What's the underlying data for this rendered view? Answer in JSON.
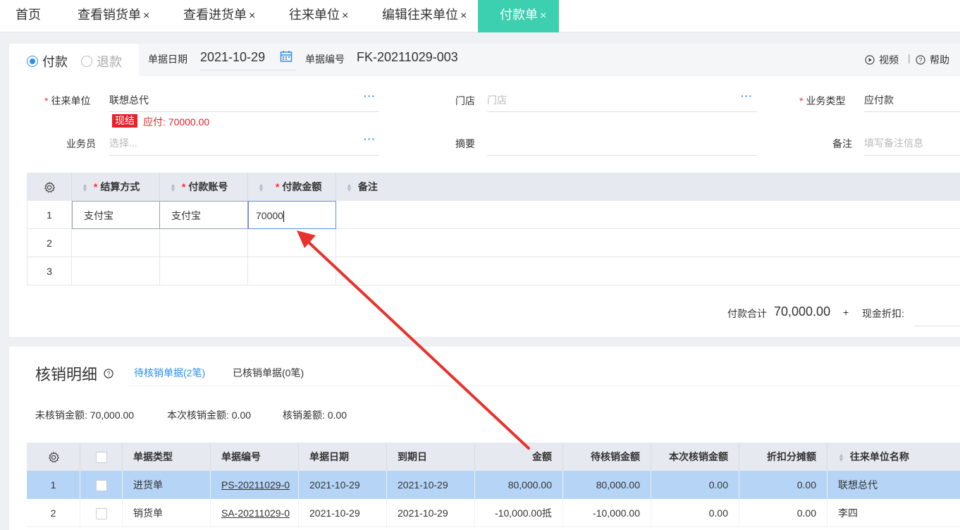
{
  "tabs": [
    {
      "label": "首页",
      "closable": false
    },
    {
      "label": "查看销货单",
      "closable": true
    },
    {
      "label": "查看进货单",
      "closable": true
    },
    {
      "label": "往来单位",
      "closable": true
    },
    {
      "label": "编辑往来单位",
      "closable": true
    },
    {
      "label": "付款单",
      "closable": true,
      "active": true
    }
  ],
  "close_glyph": "×",
  "header": {
    "radio_pay": "付款",
    "radio_refund": "退款",
    "date_label": "单据日期",
    "date_value": "2021-10-29",
    "no_label": "单据编号",
    "no_value": "FK-20211029-003",
    "video_label": "视频",
    "sep": "|",
    "help_label": "帮助"
  },
  "form": {
    "partner_label": "往来单位",
    "partner_value": "联想总代",
    "settle_badge": "现结",
    "payable_text": "应付: 70000.00",
    "store_label": "门店",
    "store_placeholder": "门店",
    "biz_type_label": "业务类型",
    "biz_type_value": "应付款",
    "staff_label": "业务员",
    "staff_placeholder": "选择...",
    "summary_label": "摘要",
    "remark_label": "备注",
    "remark_placeholder": "填写备注信息",
    "more_glyph": "···",
    "required_mark": "*"
  },
  "pay_grid": {
    "headers": [
      "结算方式",
      "付款账号",
      "付款金额",
      "备注"
    ],
    "rows": [
      {
        "no": "1",
        "method": "支付宝",
        "account": "支付宝",
        "amount": "70000",
        "note": ""
      },
      {
        "no": "2",
        "method": "",
        "account": "",
        "amount": "",
        "note": ""
      },
      {
        "no": "3",
        "method": "",
        "account": "",
        "amount": "",
        "note": ""
      }
    ],
    "total_label": "付款合计",
    "total_value": "70,000.00",
    "plus": "+",
    "discount_label": "现金折扣:"
  },
  "verify": {
    "title": "核销明细",
    "tab_pending": "待核销单据(2笔)",
    "tab_done": "已核销单据(0笔)",
    "unverified": "未核销金额: 70,000.00",
    "this_time": "本次核销金额: 0.00",
    "diff": "核销差额: 0.00",
    "headers": [
      "单据类型",
      "单据编号",
      "单据日期",
      "到期日",
      "金额",
      "待核销金额",
      "本次核销金额",
      "折扣分摊额",
      "往来单位名称"
    ],
    "rows": [
      {
        "no": "1",
        "type": "进货单",
        "doc_no": "PS-20211029-0",
        "date": "2021-10-29",
        "due": "2021-10-29",
        "amount": "80,000.00",
        "pending": "80,000.00",
        "this_time": "0.00",
        "discount": "0.00",
        "partner": "联想总代",
        "selected": true
      },
      {
        "no": "2",
        "type": "销货单",
        "doc_no": "SA-20211029-0",
        "date": "2021-10-29",
        "due": "2021-10-29",
        "amount": "-10,000.00抵",
        "pending": "-10,000.00",
        "this_time": "0.00",
        "discount": "0.00",
        "partner": "李四",
        "selected": false
      }
    ]
  },
  "colors": {
    "accent": "#3ccfb0",
    "link": "#2b8ff0",
    "required": "#f03030",
    "badge": "#e8202a",
    "row_selected": "#b6d4f6",
    "arrow": "#e8322c"
  }
}
